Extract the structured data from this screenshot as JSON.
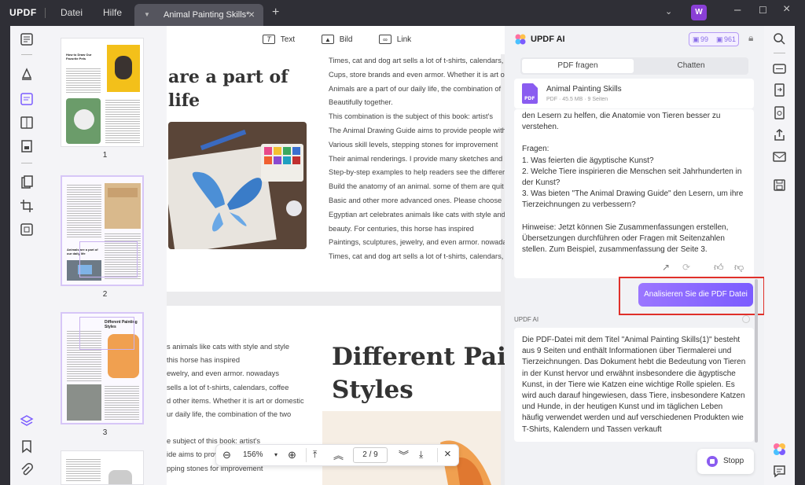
{
  "titlebar": {
    "logo": "UPDF",
    "menu_file": "Datei",
    "menu_help": "Hilfe",
    "tab_title": "Animal Painting Skills*",
    "avatar_initial": "W"
  },
  "doc_toolbar": {
    "text_label": "Text",
    "image_label": "Bild",
    "link_label": "Link"
  },
  "thumbnails": {
    "pages": [
      "1",
      "2",
      "3"
    ],
    "thumb1_title": "How to Draw Our Favorite Pets",
    "thumb2_title": "Animals are a part of our daily life",
    "thumb3_title": "Different Painting Styles"
  },
  "document": {
    "page1_heading_line1": "are a part of",
    "page1_heading_line2": "life",
    "page1_lines": [
      "Times, cat and dog art sells a lot of t-shirts, calendars,",
      "Cups, store brands and even armor. Whether it is art or",
      "Animals are a part of our daily life, the combination of",
      "Beautifully together.",
      "This combination is the subject of this book: artist's",
      "The Animal Drawing Guide aims to provide people with",
      "Various skill levels, stepping stones for improvement",
      "Their animal renderings. I provide many sketches and",
      "Step-by-step examples to help readers see the differer",
      "Build the anatomy of an animal. some of them are quit",
      "Basic and other more advanced ones. Please choose",
      "Egyptian art celebrates animals like cats with style and",
      "beauty. For centuries, this horse has inspired",
      "Paintings, sculptures, jewelry, and even armor. nowada",
      "Times, cat and dog art sells a lot of t-shirts, calendars,"
    ],
    "page2_lines": [
      "s animals like cats with style and style",
      "this horse has inspired",
      "ewelry, and even armor. nowadays",
      "sells a lot of t-shirts, calendars, coffee",
      "d other items. Whether it is art or domestic",
      "ur daily life, the combination of the two",
      "",
      "e subject of this book: artist's",
      "ide aims to provide",
      "pping stones for improvement"
    ],
    "page2_heading_line1": "Different Painti",
    "page2_heading_line2": "Styles"
  },
  "zoombar": {
    "zoom": "156%",
    "page_current": "2",
    "page_sep": "/",
    "page_total": "9"
  },
  "ai": {
    "title": "UPDF AI",
    "credits_a": "99",
    "credits_b": "961",
    "tab_pdf": "PDF fragen",
    "tab_chat": "Chatten",
    "file_name": "Animal Painting Skills",
    "file_meta": "PDF · 45.5 MB · 9 Seiten",
    "chat1_lines": [
      "den Lesern zu helfen, die Anatomie von Tieren besser zu",
      "verstehen.",
      "",
      "Fragen:",
      "1. Was feierten die ägyptische Kunst?",
      "2. Welche Tiere inspirieren die Menschen seit Jahrhunderten in",
      "der Kunst?",
      "3. Was bieten \"The Animal Drawing Guide\" den Lesern, um ihre",
      "Tierzeichnungen zu verbessern?",
      "",
      "Hinweise: Jetzt können Sie Zusammenfassungen erstellen,",
      "Übersetzungen durchführen oder Fragen mit Seitenzahlen",
      "stellen. Zum Beispiel, zusammenfassung der Seite 3."
    ],
    "analyze_button": "Analisieren Sie die PDF Datei",
    "ai_label": "UPDF AI",
    "chat2_lines": [
      "Die PDF-Datei mit dem Titel \"Animal Painting Skills(1)\" besteht",
      "aus 9 Seiten und enthält Informationen über Tiermalerei und",
      "Tierzeichnungen. Das Dokument hebt die Bedeutung von Tieren",
      "in der Kunst hervor und erwähnt insbesondere die ägyptische",
      "Kunst, in der Tiere wie Katzen eine wichtige Rolle spielen. Es",
      "wird auch darauf hingewiesen, dass Tiere, insbesondere Katzen",
      "und Hunde, in der heutigen Kunst und im täglichen Leben",
      "häufig verwendet werden und auf verschiedenen Produkten wie",
      "T-Shirts, Kalendern und Tassen verkauft"
    ],
    "stop_button": "Stopp"
  },
  "colors": {
    "accent": "#7b5cff",
    "highlight_border": "#e0302a",
    "titlebar_bg": "#2f2f36"
  }
}
